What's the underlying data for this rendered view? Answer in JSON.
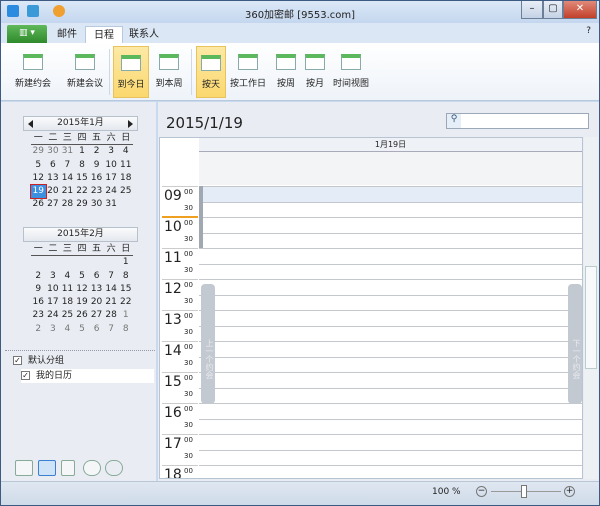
{
  "window": {
    "title": "360加密邮 [9553.com]",
    "controls": [
      "–",
      "▢",
      "✕"
    ]
  },
  "tabs": [
    {
      "label": "邮件"
    },
    {
      "label": "日程",
      "active": true
    },
    {
      "label": "联系人"
    }
  ],
  "app_button": "▥ ▾",
  "ribbon": [
    {
      "label": "新建约会",
      "sel": false
    },
    {
      "label": "新建会议",
      "sel": false
    },
    {
      "label": "到今日",
      "sel": true
    },
    {
      "label": "到本周",
      "sel": false
    },
    {
      "label": "按天",
      "sel": true
    },
    {
      "label": "按工作日",
      "sel": false
    },
    {
      "label": "按周",
      "sel": false
    },
    {
      "label": "按月",
      "sel": false
    },
    {
      "label": "时间视图",
      "sel": false
    }
  ],
  "mini_calendars": [
    {
      "title": "2015年1月",
      "weekdays": [
        "一",
        "二",
        "三",
        "四",
        "五",
        "六",
        "日"
      ],
      "days": [
        "29",
        "30",
        "31",
        "1",
        "2",
        "3",
        "4",
        "5",
        "6",
        "7",
        "8",
        "9",
        "10",
        "11",
        "12",
        "13",
        "14",
        "15",
        "16",
        "17",
        "18",
        "19",
        "20",
        "21",
        "22",
        "23",
        "24",
        "25",
        "26",
        "27",
        "28",
        "29",
        "30",
        "31"
      ],
      "dim_leading": 3,
      "dim_trailing": 0,
      "today": "19"
    },
    {
      "title": "2015年2月",
      "weekdays": [
        "一",
        "二",
        "三",
        "四",
        "五",
        "六",
        "日"
      ],
      "days": [
        "",
        "",
        "",
        "",
        "",
        "",
        "1",
        "2",
        "3",
        "4",
        "5",
        "6",
        "7",
        "8",
        "9",
        "10",
        "11",
        "12",
        "13",
        "14",
        "15",
        "16",
        "17",
        "18",
        "19",
        "20",
        "21",
        "22",
        "23",
        "24",
        "25",
        "26",
        "27",
        "28",
        "1",
        "2",
        "3",
        "4",
        "5",
        "6",
        "7",
        "8"
      ],
      "dim_leading": 0,
      "dim_trailing": 8
    }
  ],
  "groups": {
    "group": "默认分组",
    "calendar": "我的日历"
  },
  "main": {
    "date_title": "2015/1/19",
    "day_header": "1月19日",
    "search_placeholder": "",
    "prev_label": "上一个约会",
    "next_label": "下一个约会"
  },
  "hours": [
    "09",
    "10",
    "11",
    "12",
    "13",
    "14",
    "15",
    "16",
    "17",
    "18"
  ],
  "minutes": [
    "00",
    "30"
  ],
  "status": {
    "zoom": "100 %"
  }
}
